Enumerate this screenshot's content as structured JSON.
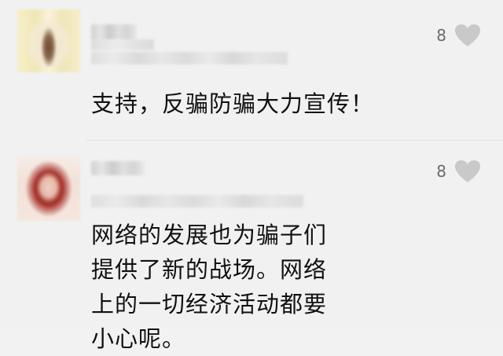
{
  "comments": [
    {
      "likes": "8",
      "text": "支持，反骗防骗大力宣传！"
    },
    {
      "likes": "8",
      "text": "网络的发展也为骗子们提供了新的战场。网络上的一切经济活动都要小心呢。"
    }
  ],
  "colors": {
    "background": "#f1f1f1",
    "heart": "#c9c9c9",
    "count": "#6a6a6a"
  },
  "icons": {
    "like": "heart-icon"
  }
}
